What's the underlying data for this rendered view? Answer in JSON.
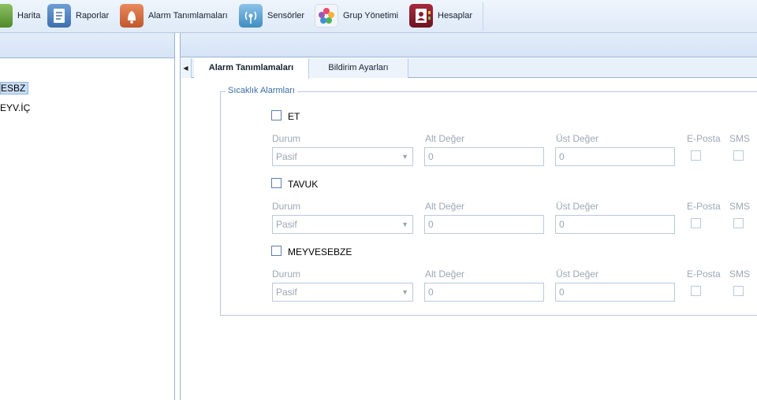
{
  "toolbar": {
    "items": [
      {
        "label": "Harita",
        "icon": "map-icon",
        "color": "#6a9f3a"
      },
      {
        "label": "Raporlar",
        "icon": "report-icon",
        "color": "#4a7fbf"
      },
      {
        "label": "Alarm Tanımlamaları",
        "icon": "alarm-bell-icon",
        "color": "#d0693c"
      },
      {
        "label": "Sensörler",
        "icon": "sensor-signal-icon",
        "color": "#5aa0cf"
      },
      {
        "label": "Grup Yönetimi",
        "icon": "flower-group-icon",
        "color": "#e8eef6"
      },
      {
        "label": "Hesaplar",
        "icon": "accounts-icon",
        "color": "#8b1e2e"
      }
    ]
  },
  "tree": {
    "items": [
      {
        "label": "ESBZ",
        "selected": true
      },
      {
        "label": "EYV.İÇ",
        "selected": false
      }
    ]
  },
  "tabs": {
    "active": "Alarm Tanımlamaları",
    "inactive": "Bildirim Ayarları"
  },
  "section": {
    "legend": "Sıcaklık Alarmları",
    "field_labels": {
      "status": "Durum",
      "lower": "Alt Değer",
      "upper": "Üst Değer",
      "email": "E-Posta",
      "sms": "SMS"
    },
    "groups": [
      {
        "name": "ET",
        "status": "Pasif",
        "lower": "0",
        "upper": "0"
      },
      {
        "name": "TAVUK",
        "status": "Pasif",
        "lower": "0",
        "upper": "0"
      },
      {
        "name": "MEYVESEBZE",
        "status": "Pasif",
        "lower": "0",
        "upper": "0"
      }
    ]
  }
}
